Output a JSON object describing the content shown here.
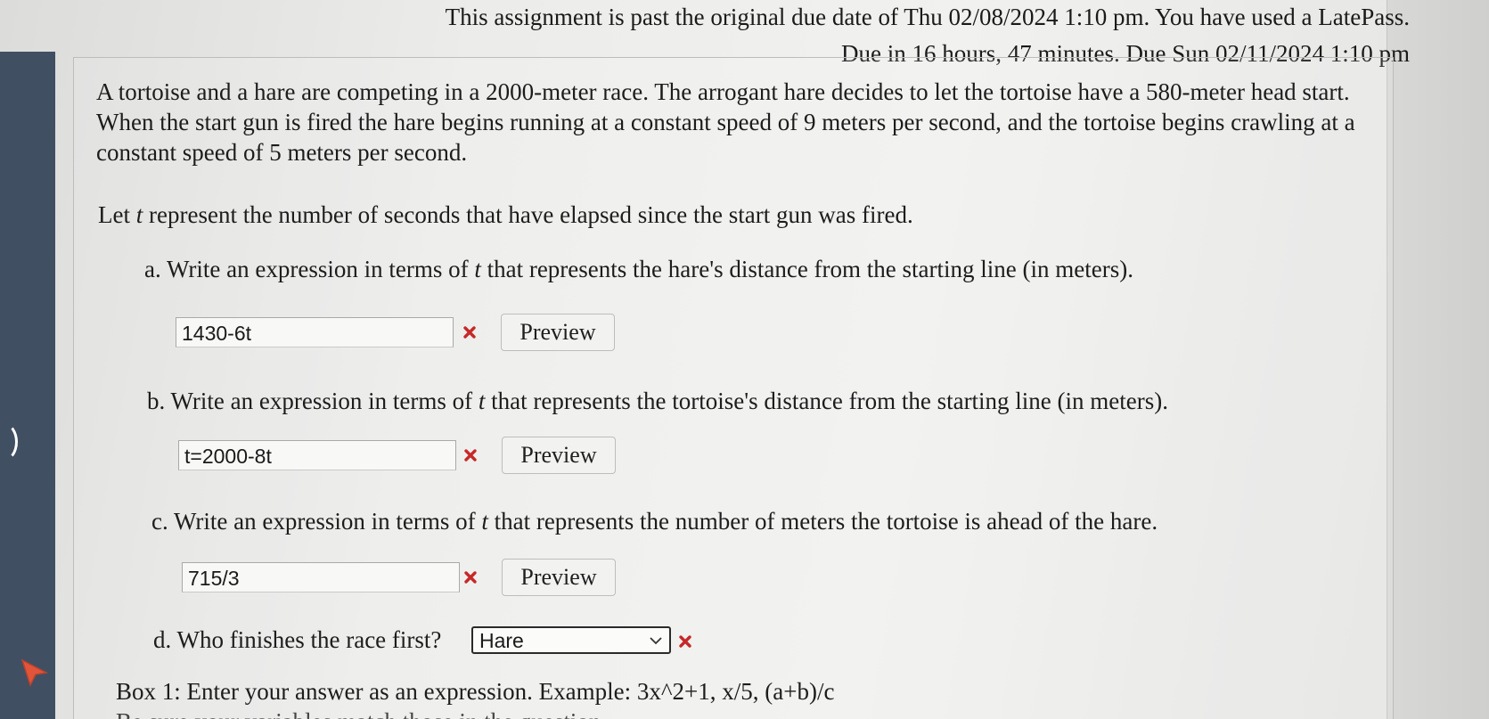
{
  "header": {
    "line1": "This assignment is past the original due date of Thu 02/08/2024 1:10 pm. You have used a LatePass.",
    "line2": "Due in 16 hours, 47 minutes. Due Sun 02/11/2024 1:10 pm"
  },
  "problem": {
    "text": "A tortoise and a hare are competing in a 2000-meter race. The arrogant hare decides to let the tortoise have a 580-meter head start. When the start gun is fired the hare begins running at a constant speed of 9 meters per second, and the tortoise begins crawling at a constant speed of 5 meters per second.",
    "let_before": "Let ",
    "let_var": "t",
    "let_after": " represent the number of seconds that have elapsed since the start gun was fired."
  },
  "parts": {
    "a": {
      "before": "a. Write an expression in terms of ",
      "var": "t",
      "after": " that represents the hare's distance from the starting line (in meters).",
      "answer": "1430-6t"
    },
    "b": {
      "before": "b. Write an expression in terms of ",
      "var": "t",
      "after": " that represents the tortoise's distance from the starting line (in meters).",
      "answer": "t=2000-8t"
    },
    "c": {
      "before": "c. Write an expression in terms of ",
      "var": "t",
      "after": " that represents the number of meters the tortoise is ahead of the hare.",
      "answer": "715/3"
    },
    "d": {
      "label": "d. Who finishes the race first?",
      "selected": "Hare"
    }
  },
  "buttons": {
    "preview_label": "Preview"
  },
  "hint": {
    "line1": "Box 1: Enter your answer as an expression. Example: 3x^2+1, x/5, (a+b)/c",
    "line2": "Be sure your variables match those in the question"
  },
  "colors": {
    "incorrect": "#c62828",
    "sidebar": "#414f63",
    "cursor": "#e0553a"
  },
  "icons": {
    "incorrect": "x-mark-icon",
    "dropdown": "chevron-down-icon",
    "pointer": "mouse-cursor-icon"
  }
}
